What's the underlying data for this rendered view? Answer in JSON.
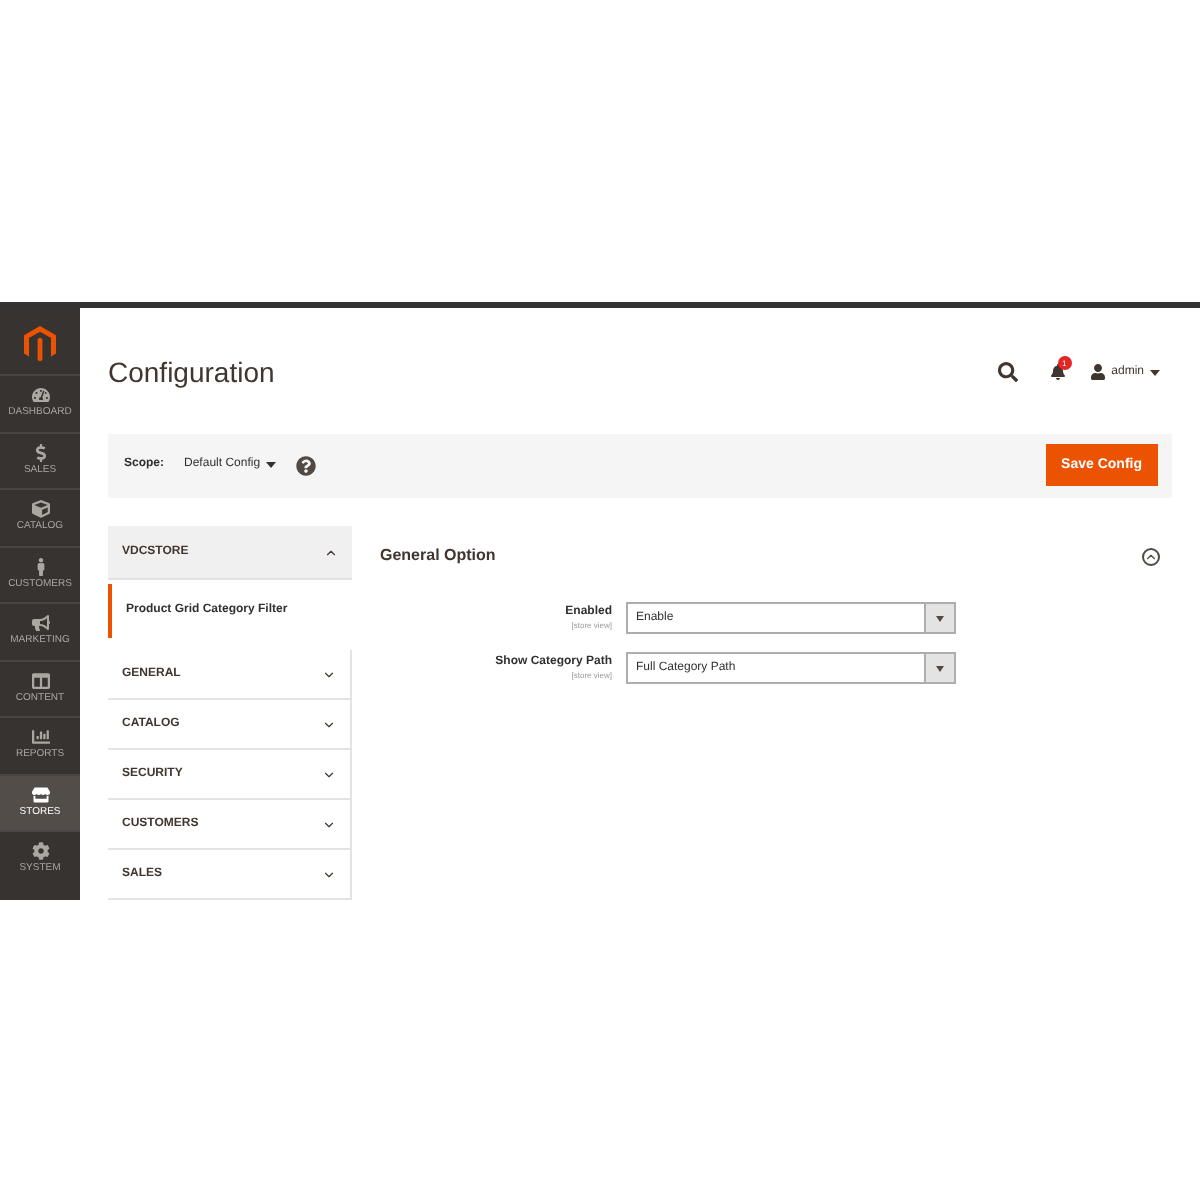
{
  "sidebar": {
    "items": [
      {
        "label": "DASHBOARD",
        "selected": false
      },
      {
        "label": "SALES",
        "selected": false
      },
      {
        "label": "CATALOG",
        "selected": false
      },
      {
        "label": "CUSTOMERS",
        "selected": false
      },
      {
        "label": "MARKETING",
        "selected": false
      },
      {
        "label": "CONTENT",
        "selected": false
      },
      {
        "label": "REPORTS",
        "selected": false
      },
      {
        "label": "STORES",
        "selected": true
      },
      {
        "label": "SYSTEM",
        "selected": false
      }
    ]
  },
  "header": {
    "title": "Configuration",
    "notification_count": "1",
    "user": "admin"
  },
  "scope_bar": {
    "label": "Scope:",
    "value": "Default Config",
    "button": "Save Config"
  },
  "config_tabs": [
    {
      "label": "VDCSTORE",
      "expanded": true,
      "children": [
        {
          "label": "Product Grid Category Filter",
          "selected": true
        }
      ]
    },
    {
      "label": "GENERAL",
      "expanded": false
    },
    {
      "label": "CATALOG",
      "expanded": false
    },
    {
      "label": "SECURITY",
      "expanded": false
    },
    {
      "label": "CUSTOMERS",
      "expanded": false
    },
    {
      "label": "SALES",
      "expanded": false
    }
  ],
  "section": {
    "title": "General Option",
    "expanded": true,
    "fields": [
      {
        "label": "Enabled",
        "scope": "[store view]",
        "value": "Enable"
      },
      {
        "label": "Show Category Path",
        "scope": "[store view]",
        "value": "Full Category Path"
      }
    ]
  }
}
